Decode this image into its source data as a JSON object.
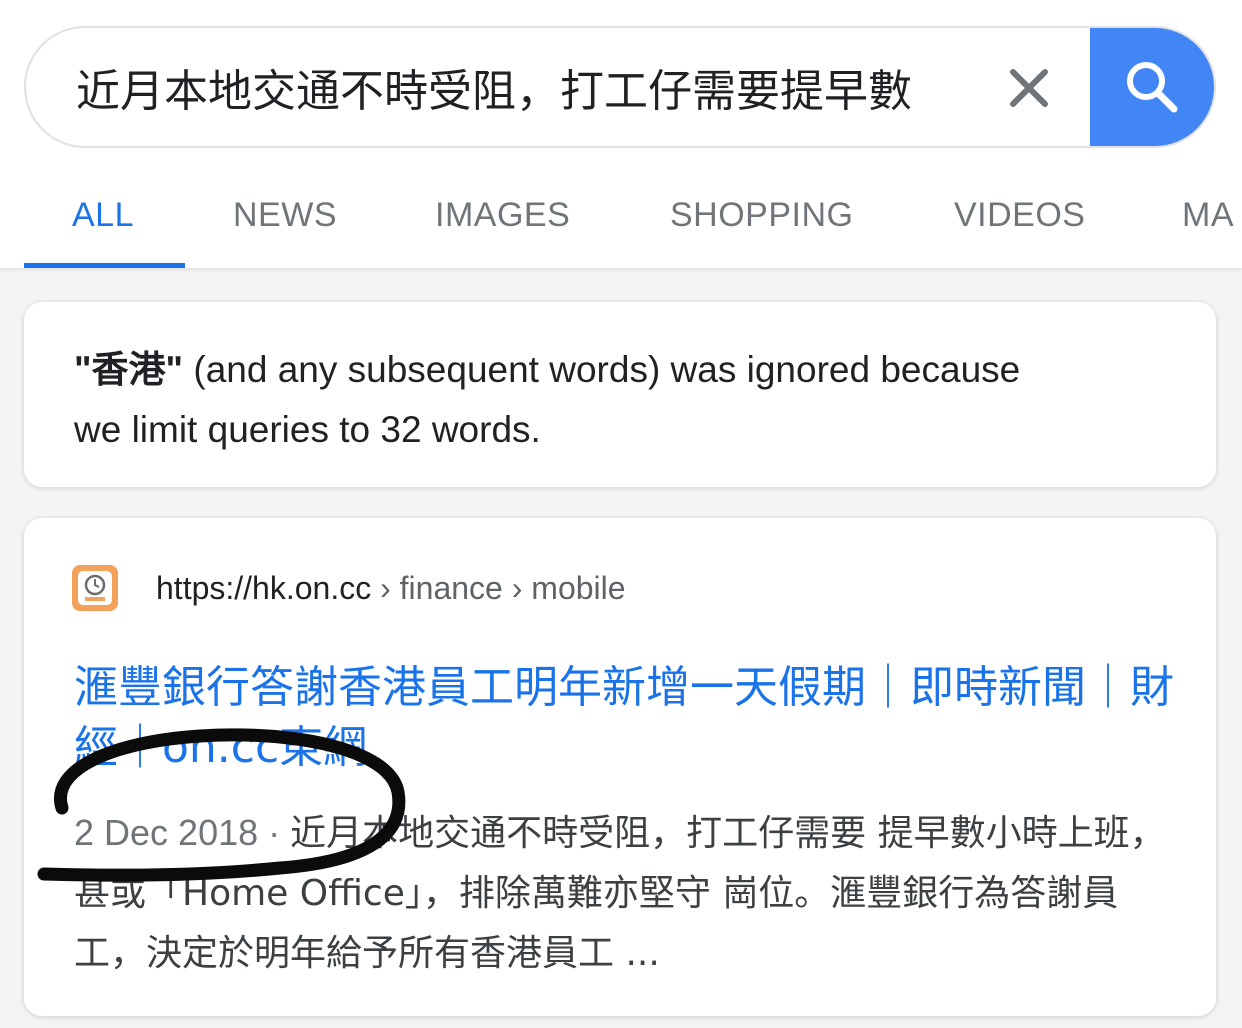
{
  "search": {
    "query": "近月本地交通不時受阻，打工仔需要提早數",
    "clear_icon": "close-icon",
    "search_icon": "magnifier-icon",
    "accent_color": "#4285f4"
  },
  "tabs": [
    {
      "label": "ALL",
      "active": true
    },
    {
      "label": "NEWS"
    },
    {
      "label": "IMAGES"
    },
    {
      "label": "SHOPPING"
    },
    {
      "label": "VIDEOS"
    },
    {
      "label": "MA"
    }
  ],
  "notice": {
    "ignored_term": "\"香港\"",
    "message_1": " (and any subsequent words) was ignored because",
    "message_2": "we limit queries to 32 words."
  },
  "result": {
    "favicon": "on-cc-logo-icon",
    "url_base": "https://hk.on.cc",
    "url_sep_1": " › ",
    "url_crumb_1": "finance",
    "url_sep_2": " › ",
    "url_crumb_2": "mobile",
    "title": "滙豐銀行答謝香港員工明年新增一天假期｜即時新聞｜財經｜on.cc東網",
    "date": "2 Dec 2018",
    "date_sep": " · ",
    "snippet": "近月本地交通不時受阻，打工仔需要 提早數小時上班，甚或「Home Office」，排除萬難亦堅守 崗位。滙豐銀行為答謝員工，決定於明年給予所有香港員工 ..."
  }
}
